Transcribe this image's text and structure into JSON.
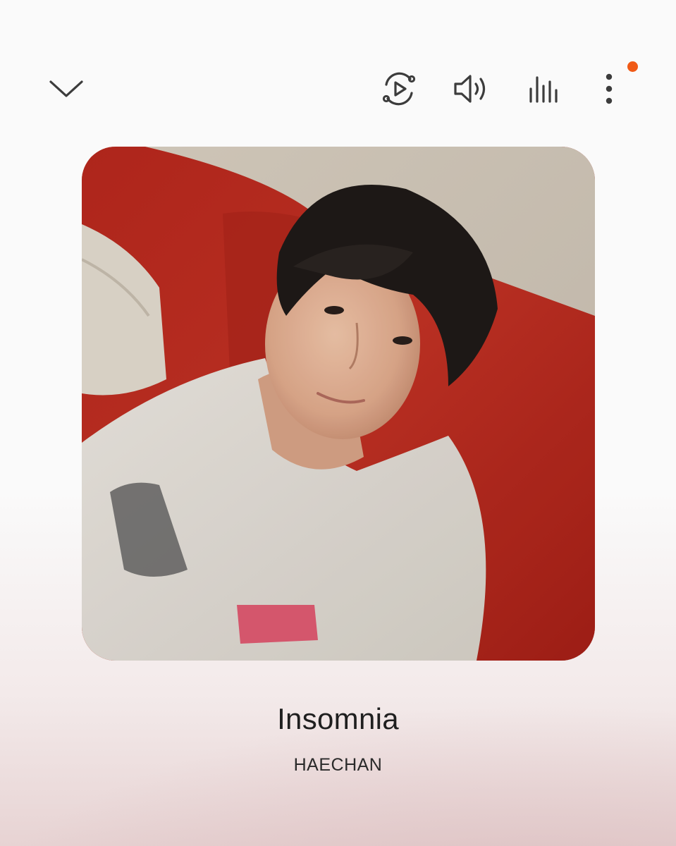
{
  "header": {
    "icons": {
      "collapse": "chevron-down-icon",
      "playback": "playback-sync-icon",
      "volume": "volume-icon",
      "equalizer": "equalizer-icon",
      "more": "more-vertical-icon"
    },
    "notification_color": "#f05a16"
  },
  "album": {
    "description_icon": "album-art-photo"
  },
  "track": {
    "title": "Insomnia",
    "artist": "HAECHAN"
  },
  "colors": {
    "text_primary": "#1f1f1f",
    "icon": "#3c3c3c",
    "accent_dot": "#f05a16"
  }
}
